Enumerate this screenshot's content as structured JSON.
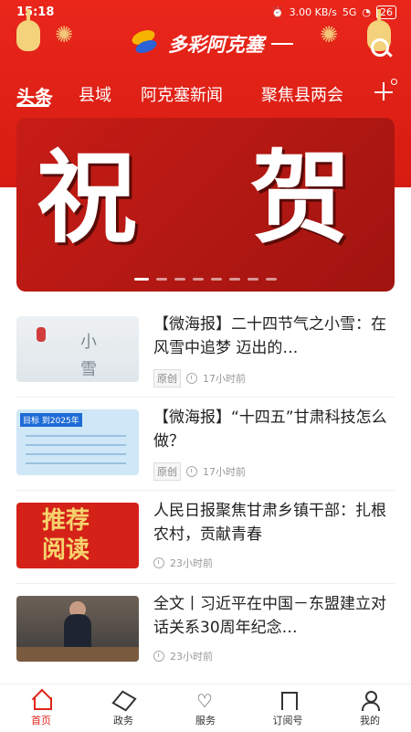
{
  "status_bar": {
    "time": "15:18",
    "speed": "3.00 KB/s",
    "network": "5G",
    "battery": "26"
  },
  "app": {
    "logo_text": "多彩阿克塞"
  },
  "tabs": [
    {
      "label": "头条",
      "active": true
    },
    {
      "label": "县域",
      "active": false
    },
    {
      "label": "阿克塞新闻",
      "active": false
    },
    {
      "label": "聚焦县两会",
      "active": false
    }
  ],
  "banner": {
    "char1": "祝",
    "char2": "贺",
    "slide_count": 8,
    "current_slide": 1
  },
  "news": [
    {
      "title": "【微海报】二十四节气之小雪：在风雪中追梦 迈出的…",
      "tag": "原创",
      "time": "17小时前",
      "thumb_text1": "小",
      "thumb_text2": "雪"
    },
    {
      "title": "【微海报】“十四五”甘肃科技怎么做？",
      "tag": "原创",
      "time": "17小时前",
      "thumb_label": "目标 到2025年"
    },
    {
      "title": "人民日报聚焦甘肃乡镇干部：扎根农村，贡献青春",
      "time": "23小时前",
      "thumb_text1": "推荐",
      "thumb_text2": "阅读"
    },
    {
      "title": "全文丨习近平在中国－东盟建立对话关系30周年纪念…",
      "time": "23小时前"
    }
  ],
  "bottom_nav": [
    {
      "label": "首页",
      "icon": "home-icon",
      "active": true
    },
    {
      "label": "政务",
      "icon": "cube-icon",
      "active": false
    },
    {
      "label": "服务",
      "icon": "heart-icon",
      "active": false
    },
    {
      "label": "订阅号",
      "icon": "bookmark-icon",
      "active": false
    },
    {
      "label": "我的",
      "icon": "user-icon",
      "active": false
    }
  ],
  "colors": {
    "primary_red": "#e0251b",
    "header_red": "#ea261b"
  }
}
